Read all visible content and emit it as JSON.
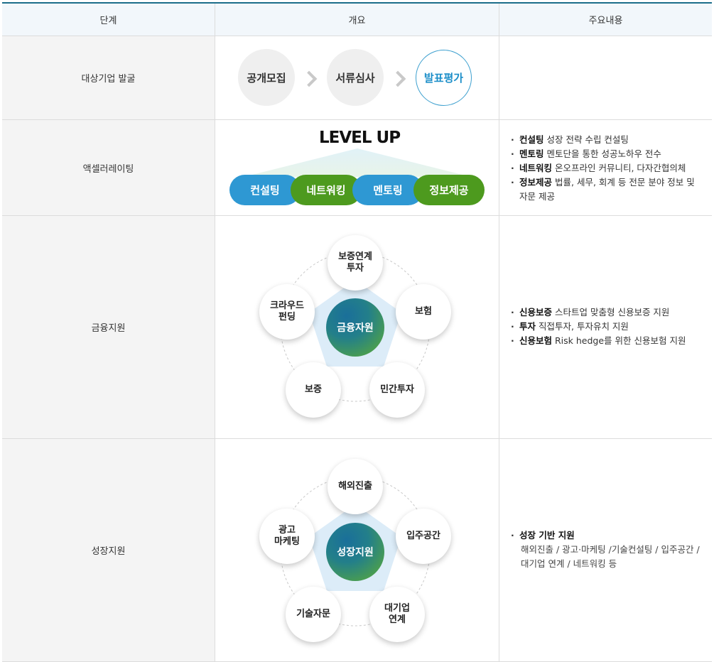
{
  "header": {
    "col1": "단계",
    "col2": "개요",
    "col3": "주요내용"
  },
  "row1": {
    "label": "대상기업 발굴",
    "steps": [
      "공개모집",
      "서류심사",
      "발표평가"
    ]
  },
  "row2": {
    "label": "액셀러레이팅",
    "title": "LEVEL UP",
    "pills": [
      "컨설팅",
      "네트워킹",
      "멘토링",
      "정보제공"
    ],
    "items": [
      {
        "term": "컨설팅",
        "desc": "성장 전략 수립 컨설팅"
      },
      {
        "term": "멘토링",
        "desc": "멘토단을 통한 성공노하우 전수"
      },
      {
        "term": "네트워킹",
        "desc": "온오프라인 커뮤니티, 다자간협의체"
      },
      {
        "term": "정보제공",
        "desc": "법률, 세무, 회계 등 전문 분야 정보 및 자문 제공"
      }
    ]
  },
  "row3": {
    "label": "금융지원",
    "center": "금융자원",
    "nodes": [
      "보증연계\n투자",
      "보험",
      "민간투자",
      "보증",
      "크라우드\n펀딩"
    ],
    "items": [
      {
        "term": "신용보증",
        "desc": "스타트업 맞춤형 신용보증 지원"
      },
      {
        "term": "투자",
        "desc": "직접투자, 투자유치 지원"
      },
      {
        "term": "신용보험",
        "desc": "Risk hedge를 위한 신용보험 지원"
      }
    ]
  },
  "row4": {
    "label": "성장지원",
    "center": "성장지원",
    "nodes": [
      "해외진출",
      "입주공간",
      "대기업\n연계",
      "기술자문",
      "광고\n마케팅"
    ],
    "heading": "성장 기반 지원",
    "detail": "해외진출 / 광고·마케팅 /기술컨설팅 / 입주공간 / 대기업 연계 / 네트워킹 등"
  },
  "colors": {
    "accent_blue": "#2e98d3",
    "accent_green": "#4d9a1e",
    "border_top": "#1b6e8a"
  }
}
